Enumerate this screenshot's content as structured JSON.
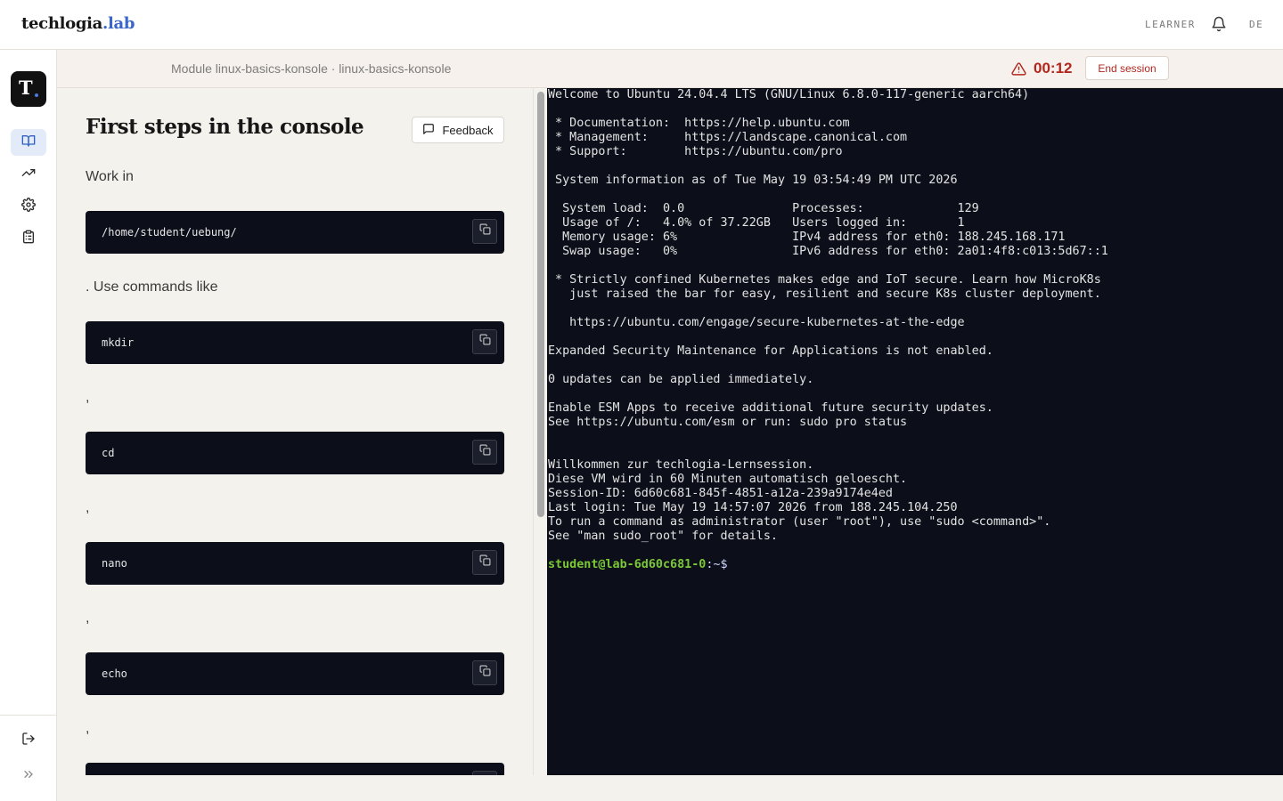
{
  "header": {
    "brand_main": "techlogia",
    "brand_suffix": ".lab",
    "role": "LEARNER",
    "language": "DE"
  },
  "sidebar": {
    "logo_letter": "T",
    "items": [
      {
        "icon": "book-open-icon",
        "active": true
      },
      {
        "icon": "trending-up-icon",
        "active": false
      },
      {
        "icon": "gear-icon",
        "active": false
      },
      {
        "icon": "clipboard-icon",
        "active": false
      }
    ],
    "bottom": [
      {
        "icon": "logout-icon"
      },
      {
        "icon": "chevrons-right-icon"
      }
    ]
  },
  "session": {
    "module_path": "Module linux-basics-konsole · linux-basics-konsole",
    "timer": "00:12",
    "end_label": "End session",
    "accent_color": "#b3261e"
  },
  "lesson": {
    "title": "First steps in the console",
    "feedback_label": "Feedback",
    "intro": "Work in",
    "work_dir": "/home/student/uebung/",
    "after_dir": ". Use commands like",
    "commands": [
      "mkdir",
      "cd",
      "nano",
      "echo"
    ],
    "separator": ","
  },
  "terminal": {
    "lines": [
      "Welcome to Ubuntu 24.04.4 LTS (GNU/Linux 6.8.0-117-generic aarch64)",
      "",
      " * Documentation:  https://help.ubuntu.com",
      " * Management:     https://landscape.canonical.com",
      " * Support:        https://ubuntu.com/pro",
      "",
      " System information as of Tue May 19 03:54:49 PM UTC 2026",
      "",
      "  System load:  0.0               Processes:             129",
      "  Usage of /:   4.0% of 37.22GB   Users logged in:       1",
      "  Memory usage: 6%                IPv4 address for eth0: 188.245.168.171",
      "  Swap usage:   0%                IPv6 address for eth0: 2a01:4f8:c013:5d67::1",
      "",
      " * Strictly confined Kubernetes makes edge and IoT secure. Learn how MicroK8s",
      "   just raised the bar for easy, resilient and secure K8s cluster deployment.",
      "",
      "   https://ubuntu.com/engage/secure-kubernetes-at-the-edge",
      "",
      "Expanded Security Maintenance for Applications is not enabled.",
      "",
      "0 updates can be applied immediately.",
      "",
      "Enable ESM Apps to receive additional future security updates.",
      "See https://ubuntu.com/esm or run: sudo pro status",
      "",
      "",
      "Willkommen zur techlogia-Lernsession.",
      "Diese VM wird in 60 Minuten automatisch geloescht.",
      "Session-ID: 6d60c681-845f-4851-a12a-239a9174e4ed",
      "Last login: Tue May 19 14:57:07 2026 from 188.245.104.250",
      "To run a command as administrator (user \"root\"), use \"sudo <command>\".",
      "See \"man sudo_root\" for details.",
      ""
    ],
    "prompt_user": "student@lab-6d60c681-0",
    "prompt_path": ":~$"
  }
}
